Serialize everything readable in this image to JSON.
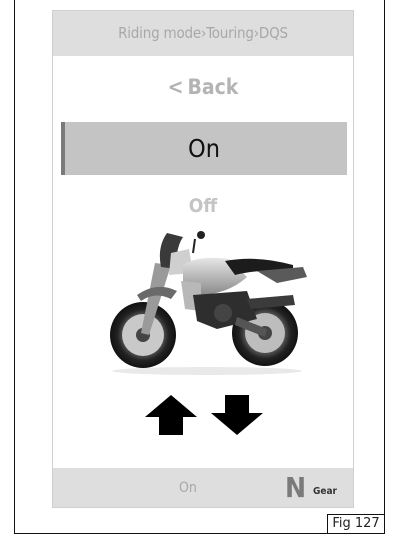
{
  "header": {
    "breadcrumb": "Riding mode›Touring›DQS"
  },
  "menu": {
    "back_chevron": "<",
    "back_label": "Back",
    "selected_label": "On",
    "other_label": "Off"
  },
  "footer": {
    "value": "On",
    "gear_value": "N",
    "gear_label": "Gear"
  },
  "figure_caption": "Fig 127",
  "icons": {
    "up": "arrow-up-icon",
    "down": "arrow-down-icon",
    "image": "motorcycle-image"
  },
  "colors": {
    "header_bg": "#dedede",
    "selected_bg": "#c4c4c4",
    "muted_text": "#b4b4b4"
  }
}
